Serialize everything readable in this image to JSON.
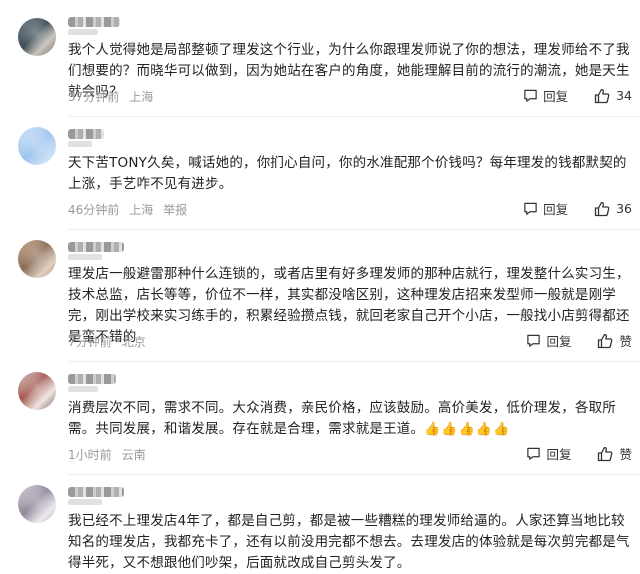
{
  "comments": [
    {
      "text": "我个人觉得她是局部整顿了理发这个行业，为什么你跟理发师说了你的想法，理发师给不了我们想要的？而晓华可以做到，因为她站在客户的角度，她能理解目前的流行的潮流，她是天生就会吗？",
      "time": "37分钟前",
      "location": "上海",
      "report": "",
      "reply_label": "回复",
      "likes": "34"
    },
    {
      "text": "天下苦TONY久矣，喊话她的，你扪心自问，你的水准配那个价钱吗？每年理发的钱都默契的上涨，手艺咋不见有进步。",
      "time": "46分钟前",
      "location": "上海",
      "report": "举报",
      "reply_label": "回复",
      "likes": "36"
    },
    {
      "text": "理发店一般避雷那种什么连锁的，或者店里有好多理发师的那种店就行，理发整什么实习生，技术总监，店长等等，价位不一样，其实都没啥区别，这种理发店招来发型师一般就是刚学完，刚出学校来实习练手的，积累经验攒点钱，就回老家自己开个小店，一般找小店剪得都还是蛮不错的",
      "time": "7分钟前",
      "location": "北京",
      "report": "",
      "reply_label": "回复",
      "likes": "赞"
    },
    {
      "text": "消费层次不同，需求不同。大众消费，亲民价格，应该鼓励。高价美发，低价理发，各取所需。共同发展，和谐发展。存在就是合理，需求就是王道。",
      "emojis": "👍👍👍👍👍",
      "time": "1小时前",
      "location": "云南",
      "report": "",
      "reply_label": "回复",
      "likes": "赞"
    },
    {
      "text": "我已经不上理发店4年了，都是自己剪，都是被一些糟糕的理发师给逼的。人家还算当地比较知名的理发店，我都充卡了，还有以前没用完都不想去。去理发店的体验就是每次剪完都是气得半死，又不想跟他们吵架，后面就改成自己剪头发了。",
      "time": "",
      "location": "",
      "report": "",
      "reply_label": "",
      "likes": ""
    }
  ],
  "colors": {
    "text": "#222222",
    "meta": "#9a9a9a",
    "icon": "#333333"
  }
}
